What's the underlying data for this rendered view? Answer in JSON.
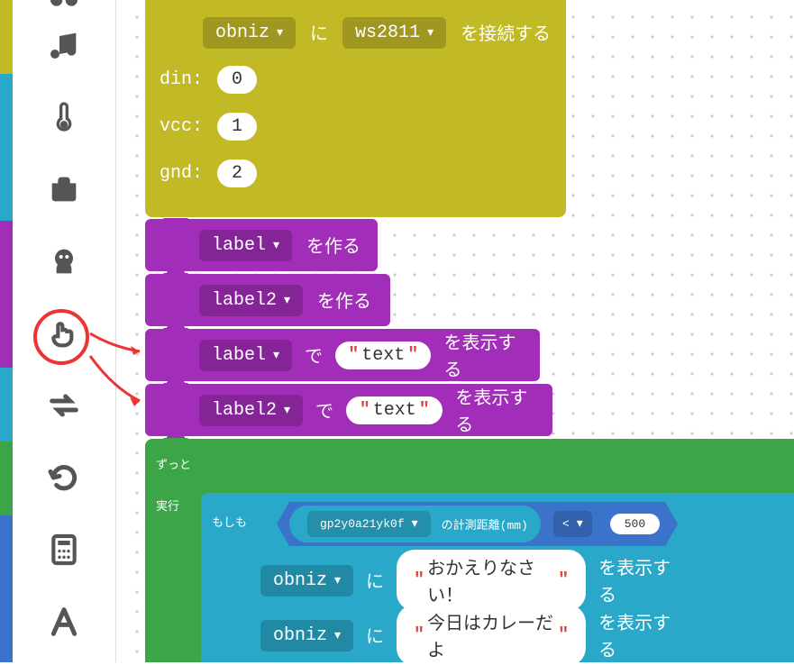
{
  "colorbar": [
    "#c2b926",
    "#c2b926",
    "#2aa8c9",
    "#2aa8c9",
    "#2aa8c9",
    "#a22db8",
    "#a22db8",
    "#2aa8c9",
    "#3ba548",
    "#3a73c9"
  ],
  "yellow": {
    "obniz": "obniz",
    "ni": "に",
    "ws2811": "ws2811",
    "connect": "を接続する",
    "din_label": "din:",
    "din_val": "0",
    "vcc_label": "vcc:",
    "vcc_val": "1",
    "gnd_label": "gnd:",
    "gnd_val": "2"
  },
  "purple": {
    "make": "を作る",
    "show": "を表示する",
    "de": "で",
    "label1": "label",
    "label2": "label2",
    "text": "text"
  },
  "green": {
    "forever": "ずっと",
    "exec": "実行"
  },
  "cyan": {
    "if": "もしも",
    "sensor": "gp2y0a21yk0f",
    "distance": "の計測距離(mm)",
    "lt": "<",
    "threshold": "500",
    "obniz": "obniz",
    "ni": "に",
    "show": "を表示する",
    "msg1": "おかえりなさい！",
    "msg2": "今日はカレーだよ"
  }
}
